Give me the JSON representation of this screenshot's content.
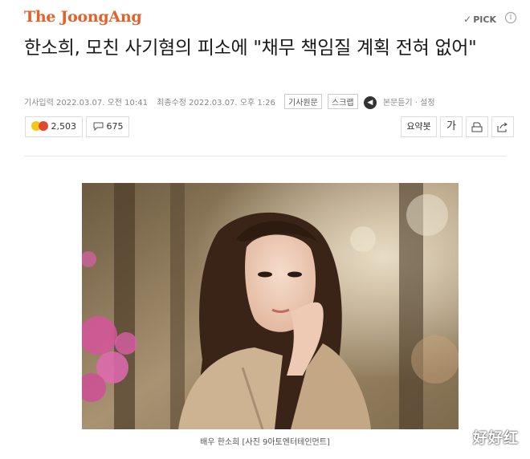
{
  "header": {
    "logo": "The JoongAng",
    "pick_label": "PICK",
    "info": "i"
  },
  "article": {
    "headline": "한소희, 모친 사기혐의 피소에 \"채무 책임질 계획 전혀 없어\"",
    "published": "기사입력 2022.03.07. 오전 10:41",
    "modified": "최종수정 2022.03.07. 오후 1:26",
    "original_btn": "기사원문",
    "scrap_btn": "스크랩",
    "listen_label": "본문듣기 · 설정"
  },
  "reactions": {
    "like_count": "2,503",
    "comment_count": "675"
  },
  "tools": {
    "summary": "요약봇",
    "font": "가"
  },
  "photo": {
    "caption": "배우 한소희 [사진 9아토엔터테인먼트]"
  },
  "watermark": "好好红",
  "colors": {
    "brand": "#e5612a"
  }
}
